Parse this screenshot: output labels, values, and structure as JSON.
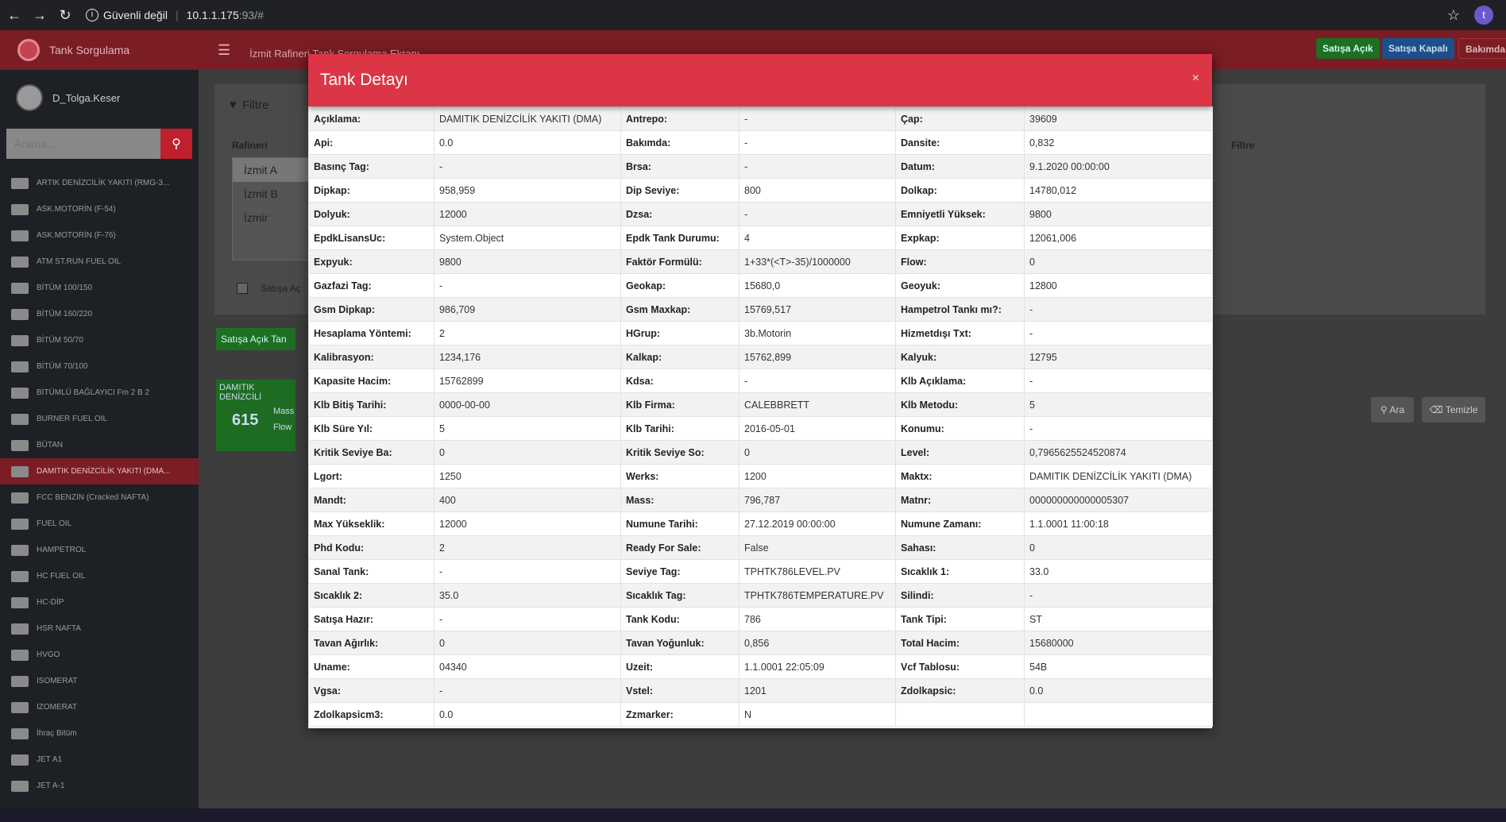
{
  "browser": {
    "security": "Güvenli değil",
    "url_host": "10.1.1.175",
    "url_rest": ":93/#",
    "profile": "t"
  },
  "app": {
    "brand": "Tank Sorgulama",
    "user": "D_Tolga.Keser",
    "search_placeholder": "Arama...",
    "title": "İzmit Rafineri Tank Sorgulama Ekranı"
  },
  "top_buttons": {
    "open": "Satışa Açık",
    "closed": "Satışa Kapalı",
    "maintenance": "Bakımda"
  },
  "sidebar_items": [
    "ARTIK DENİZCİLİK YAKITI (RMG-3...",
    "ASK.MOTORİN (F-54)",
    "ASK.MOTORİN (F-76)",
    "ATM ST.RUN FUEL OIL",
    "BİTÜM 100/150",
    "BİTÜM 160/220",
    "BİTÜM 50/70",
    "BİTÜM 70/100",
    "BİTÜMLÜ BAĞLAYICI Fm 2 B 2",
    "BURNER FUEL OIL",
    "BÜTAN",
    "DAMITIK DENİZCİLİK YAKITI (DMA...",
    "FCC BENZIN (Cracked NAFTA)",
    "FUEL OIL",
    "HAMPETROL",
    "HC FUEL OIL",
    "HC-DİP",
    "HSR NAFTA",
    "HVGO",
    "ISOMERAT",
    "IZOMERAT",
    "İhraç Bitüm",
    "JET A1",
    "JET A-1"
  ],
  "filter": {
    "title": "Filtre",
    "rafineri_label": "Rafineri",
    "refineries": [
      "İzmit A",
      "İzmit B",
      "İzmir"
    ],
    "satis_label": "Satışa Aç",
    "right_label": "Filtre",
    "green_button": "Satışa Açık Tan",
    "card_title": "DAMITIK DENİZCİLİ",
    "card_number": "615",
    "card_l1": "Mass",
    "card_l2": "Flow",
    "search_btn": "Ara",
    "clear_btn": "Temizle"
  },
  "modal": {
    "title": "Tank Detayı",
    "close": "×",
    "rows": [
      [
        [
          "Açıklama:",
          "DAMITIK DENİZCİLİK YAKITI (DMA)"
        ],
        [
          "Antrepo:",
          "-"
        ],
        [
          "Çap:",
          "39609"
        ]
      ],
      [
        [
          "Api:",
          "0.0"
        ],
        [
          "Bakımda:",
          "-"
        ],
        [
          "Dansite:",
          "0,832"
        ]
      ],
      [
        [
          "Basınç Tag:",
          "-"
        ],
        [
          "Brsa:",
          "-"
        ],
        [
          "Datum:",
          "9.1.2020 00:00:00"
        ]
      ],
      [
        [
          "Dipkap:",
          "958,959"
        ],
        [
          "Dip Seviye:",
          "800"
        ],
        [
          "Dolkap:",
          "14780,012"
        ]
      ],
      [
        [
          "Dolyuk:",
          "12000"
        ],
        [
          "Dzsa:",
          "-"
        ],
        [
          "Emniyetli Yüksek:",
          "9800"
        ]
      ],
      [
        [
          "EpdkLisansUc:",
          "System.Object"
        ],
        [
          "Epdk Tank Durumu:",
          "4"
        ],
        [
          "Expkap:",
          "12061,006"
        ]
      ],
      [
        [
          "Expyuk:",
          "9800"
        ],
        [
          "Faktör Formülü:",
          "1+33*(<T>-35)/1000000"
        ],
        [
          "Flow:",
          "0"
        ]
      ],
      [
        [
          "Gazfazi Tag:",
          "-"
        ],
        [
          "Geokap:",
          "15680,0"
        ],
        [
          "Geoyuk:",
          "12800"
        ]
      ],
      [
        [
          "Gsm Dipkap:",
          "986,709"
        ],
        [
          "Gsm Maxkap:",
          "15769,517"
        ],
        [
          "Hampetrol Tankı mı?:",
          "-"
        ]
      ],
      [
        [
          "Hesaplama Yöntemi:",
          "2"
        ],
        [
          "HGrup:",
          "3b.Motorin"
        ],
        [
          "Hizmetdışı Txt:",
          "-"
        ]
      ],
      [
        [
          "Kalibrasyon:",
          "1234,176"
        ],
        [
          "Kalkap:",
          "15762,899"
        ],
        [
          "Kalyuk:",
          "12795"
        ]
      ],
      [
        [
          "Kapasite Hacim:",
          "15762899"
        ],
        [
          "Kdsa:",
          "-"
        ],
        [
          "Klb Açıklama:",
          "-"
        ]
      ],
      [
        [
          "Klb Bitiş Tarihi:",
          "0000-00-00"
        ],
        [
          "Klb Firma:",
          "CALEBBRETT"
        ],
        [
          "Klb Metodu:",
          "5"
        ]
      ],
      [
        [
          "Klb Süre Yıl:",
          "5"
        ],
        [
          "Klb Tarihi:",
          "2016-05-01"
        ],
        [
          "Konumu:",
          "-"
        ]
      ],
      [
        [
          "Kritik Seviye Ba:",
          "0"
        ],
        [
          "Kritik Seviye So:",
          "0"
        ],
        [
          "Level:",
          "0,7965625524520874"
        ]
      ],
      [
        [
          "Lgort:",
          "1250"
        ],
        [
          "Werks:",
          "1200"
        ],
        [
          "Maktx:",
          "DAMITIK DENİZCİLİK YAKITI (DMA)"
        ]
      ],
      [
        [
          "Mandt:",
          "400"
        ],
        [
          "Mass:",
          "796,787"
        ],
        [
          "Matnr:",
          "000000000000005307"
        ]
      ],
      [
        [
          "Max Yükseklik:",
          "12000"
        ],
        [
          "Numune Tarihi:",
          "27.12.2019 00:00:00"
        ],
        [
          "Numune Zamanı:",
          "1.1.0001 11:00:18"
        ]
      ],
      [
        [
          "Phd Kodu:",
          "2"
        ],
        [
          "Ready For Sale:",
          "False"
        ],
        [
          "Sahası:",
          "0"
        ]
      ],
      [
        [
          "Sanal Tank:",
          "-"
        ],
        [
          "Seviye Tag:",
          "TPHTK786LEVEL.PV"
        ],
        [
          "Sıcaklık 1:",
          "33.0"
        ]
      ],
      [
        [
          "Sıcaklık 2:",
          "35.0"
        ],
        [
          "Sıcaklık Tag:",
          "TPHTK786TEMPERATURE.PV"
        ],
        [
          "Silindi:",
          "-"
        ]
      ],
      [
        [
          "Satışa Hazır:",
          "-"
        ],
        [
          "Tank Kodu:",
          "786"
        ],
        [
          "Tank Tipi:",
          "ST"
        ]
      ],
      [
        [
          "Tavan Ağırlık:",
          "0"
        ],
        [
          "Tavan Yoğunluk:",
          "0,856"
        ],
        [
          "Total Hacim:",
          "15680000"
        ]
      ],
      [
        [
          "Uname:",
          "04340"
        ],
        [
          "Uzeit:",
          "1.1.0001 22:05:09"
        ],
        [
          "Vcf Tablosu:",
          "54B"
        ]
      ],
      [
        [
          "Vgsa:",
          "-"
        ],
        [
          "Vstel:",
          "1201"
        ],
        [
          "Zdolkapsic:",
          "0.0"
        ]
      ],
      [
        [
          "Zdolkapsicm3:",
          "0.0"
        ],
        [
          "Zzmarker:",
          "N"
        ],
        [
          "",
          ""
        ]
      ]
    ]
  }
}
